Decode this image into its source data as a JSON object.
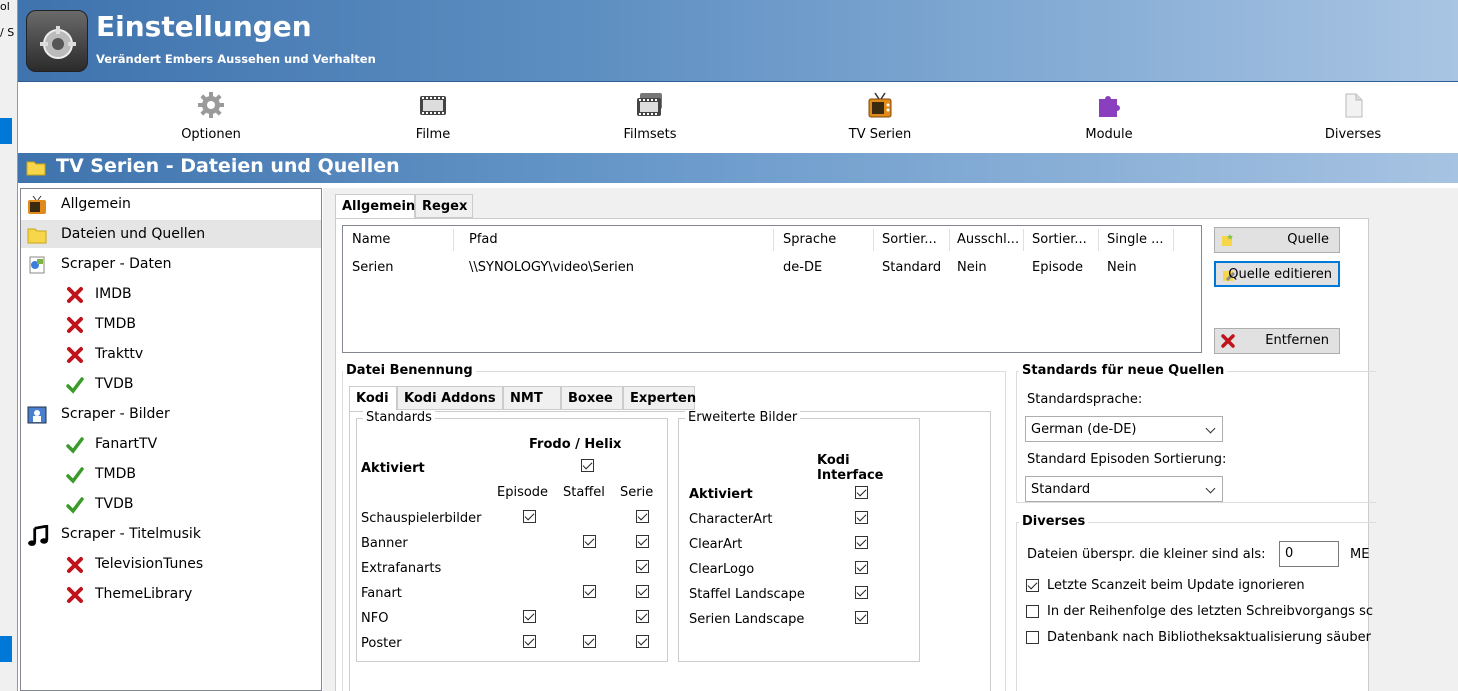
{
  "bg_window": {
    "text1": "ol",
    "text2": "/ S"
  },
  "header": {
    "title": "Einstellungen",
    "subtitle": "Verändert Embers Aussehen und Verhalten"
  },
  "toolbar": {
    "items": [
      {
        "label": "Optionen",
        "icon": "gear-icon"
      },
      {
        "label": "Filme",
        "icon": "film-icon"
      },
      {
        "label": "Filmsets",
        "icon": "filmsets-icon"
      },
      {
        "label": "TV Serien",
        "icon": "tv-icon"
      },
      {
        "label": "Module",
        "icon": "puzzle-icon"
      },
      {
        "label": "Diverses",
        "icon": "document-icon"
      }
    ]
  },
  "section": {
    "title": "TV Serien - Dateien und Quellen"
  },
  "tree": {
    "items": [
      {
        "label": "Allgemein",
        "icon": "tv-icon",
        "level": 0
      },
      {
        "label": "Dateien und Quellen",
        "icon": "folder-icon",
        "level": 0,
        "selected": true
      },
      {
        "label": "Scraper - Daten",
        "icon": "scraper-data-icon",
        "level": 0
      },
      {
        "label": "IMDB",
        "icon": "cross-icon",
        "level": 1
      },
      {
        "label": "TMDB",
        "icon": "cross-icon",
        "level": 1
      },
      {
        "label": "Trakttv",
        "icon": "cross-icon",
        "level": 1
      },
      {
        "label": "TVDB",
        "icon": "check-icon",
        "level": 1
      },
      {
        "label": "Scraper - Bilder",
        "icon": "scraper-images-icon",
        "level": 0
      },
      {
        "label": "FanartTV",
        "icon": "check-icon",
        "level": 1
      },
      {
        "label": "TMDB",
        "icon": "check-icon",
        "level": 1
      },
      {
        "label": "TVDB",
        "icon": "check-icon",
        "level": 1
      },
      {
        "label": "Scraper - Titelmusik",
        "icon": "music-note-icon",
        "level": 0
      },
      {
        "label": "TelevisionTunes",
        "icon": "cross-icon",
        "level": 1
      },
      {
        "label": "ThemeLibrary",
        "icon": "cross-icon",
        "level": 1
      }
    ]
  },
  "tabs": {
    "allgemein": "Allgemein",
    "regex": "Regex"
  },
  "sources": {
    "columns": [
      "Name",
      "Pfad",
      "Sprache",
      "Sortier...",
      "Ausschl...",
      "Sortier...",
      "Single ..."
    ],
    "rows": [
      [
        "Serien",
        "\\\\SYNOLOGY\\video\\Serien",
        "de-DE",
        "Standard",
        "Nein",
        "Episode",
        "Nein"
      ]
    ]
  },
  "buttons": {
    "add_source": "Quelle",
    "edit_source": "Quelle editieren",
    "remove": "Entfernen"
  },
  "naming": {
    "title": "Datei Benennung",
    "tabs": [
      "Kodi",
      "Kodi Addons",
      "NMT",
      "Boxee",
      "Experten"
    ],
    "standards": {
      "title": "Standards",
      "group_header": "Frodo / Helix",
      "activated_label": "Aktiviert",
      "activated": true,
      "columns": [
        "Episode",
        "Staffel",
        "Serie"
      ],
      "rows": [
        {
          "label": "Schauspielerbilder",
          "values": [
            true,
            null,
            true
          ]
        },
        {
          "label": "Banner",
          "values": [
            null,
            true,
            true
          ]
        },
        {
          "label": "Extrafanarts",
          "values": [
            null,
            null,
            true
          ]
        },
        {
          "label": "Fanart",
          "values": [
            null,
            true,
            true
          ]
        },
        {
          "label": "NFO",
          "values": [
            true,
            null,
            true
          ]
        },
        {
          "label": "Poster",
          "values": [
            true,
            true,
            true
          ]
        }
      ]
    },
    "extended": {
      "title": "Erweiterte Bilder",
      "column": "Kodi Interface",
      "rows": [
        {
          "label": "Aktiviert",
          "checked": true,
          "bold": true
        },
        {
          "label": "CharacterArt",
          "checked": true
        },
        {
          "label": "ClearArt",
          "checked": true
        },
        {
          "label": "ClearLogo",
          "checked": true
        },
        {
          "label": "Staffel Landscape",
          "checked": true
        },
        {
          "label": "Serien Landscape",
          "checked": true
        }
      ]
    }
  },
  "defaults": {
    "title": "Standards für neue Quellen",
    "language_label": "Standardsprache:",
    "language_value": "German (de-DE)",
    "sorting_label": "Standard Episoden Sortierung:",
    "sorting_value": "Standard"
  },
  "misc": {
    "title": "Diverses",
    "skip_label": "Dateien überspr. die kleiner sind als:",
    "skip_value": "0",
    "skip_unit": "ME",
    "checkboxes": [
      {
        "label": "Letzte Scanzeit beim Update ignorieren",
        "checked": true
      },
      {
        "label": "In der Reihenfolge des letzten Schreibvorgangs sc",
        "checked": false
      },
      {
        "label": "Datenbank nach Bibliotheksaktualisierung säuber",
        "checked": false
      }
    ]
  }
}
